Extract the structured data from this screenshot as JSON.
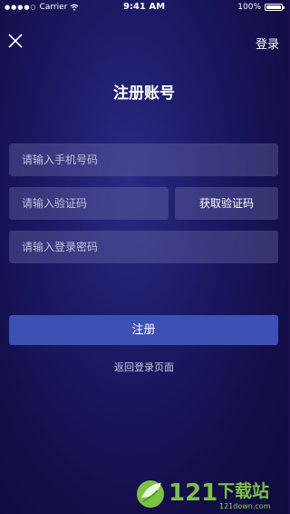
{
  "status_bar": {
    "carrier": "Carrier",
    "time": "9:41 AM",
    "battery_percent": "100%",
    "battery_level": 1.0
  },
  "nav": {
    "close_icon": "close-icon",
    "login_label": "登录"
  },
  "page_title": "注册账号",
  "form": {
    "phone_placeholder": "请输入手机号码",
    "code_placeholder": "请输入验证码",
    "get_code_label": "获取验证码",
    "password_placeholder": "请输入登录密码",
    "register_label": "注册",
    "back_to_login_label": "返回登录页面"
  },
  "watermark": {
    "text": "121下载站",
    "url_text": "121down.com"
  },
  "colors": {
    "background": "#1a1250",
    "field_background": "#4d4d8a",
    "primary_button": "#3d50b3",
    "watermark_green": "#7cc242"
  }
}
